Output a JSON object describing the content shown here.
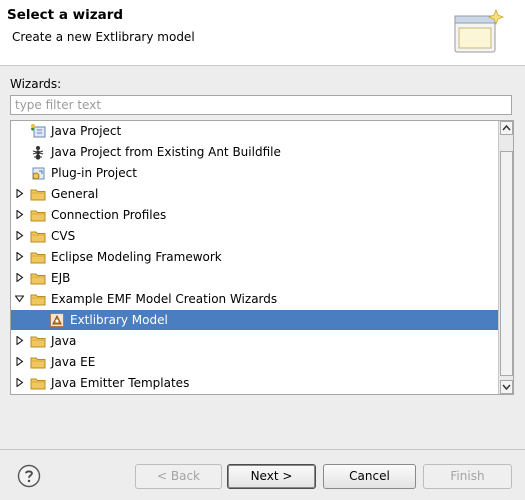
{
  "header": {
    "title": "Select a wizard",
    "description": "Create a new Extlibrary model",
    "banner_icon": "wizard-banner-icon"
  },
  "wizards_label": "Wizards:",
  "filter": {
    "placeholder": "type filter text",
    "value": ""
  },
  "tree": {
    "items": [
      {
        "label": "Java Project",
        "icon": "java-project-icon",
        "expandable": false,
        "expanded": false,
        "selected": false
      },
      {
        "label": "Java Project from Existing Ant Buildfile",
        "icon": "ant-icon",
        "expandable": false,
        "expanded": false,
        "selected": false
      },
      {
        "label": "Plug-in Project",
        "icon": "plugin-project-icon",
        "expandable": false,
        "expanded": false,
        "selected": false
      },
      {
        "label": "General",
        "icon": "folder-icon",
        "expandable": true,
        "expanded": false,
        "selected": false
      },
      {
        "label": "Connection Profiles",
        "icon": "folder-icon",
        "expandable": true,
        "expanded": false,
        "selected": false
      },
      {
        "label": "CVS",
        "icon": "folder-icon",
        "expandable": true,
        "expanded": false,
        "selected": false
      },
      {
        "label": "Eclipse Modeling Framework",
        "icon": "folder-icon",
        "expandable": true,
        "expanded": false,
        "selected": false
      },
      {
        "label": "EJB",
        "icon": "folder-icon",
        "expandable": true,
        "expanded": false,
        "selected": false
      },
      {
        "label": "Example EMF Model Creation Wizards",
        "icon": "folder-icon",
        "expandable": true,
        "expanded": true,
        "selected": false
      },
      {
        "label": "Extlibrary Model",
        "icon": "emf-model-icon",
        "expandable": false,
        "expanded": false,
        "selected": true
      },
      {
        "label": "Java",
        "icon": "folder-icon",
        "expandable": true,
        "expanded": false,
        "selected": false
      },
      {
        "label": "Java EE",
        "icon": "folder-icon",
        "expandable": true,
        "expanded": false,
        "selected": false
      },
      {
        "label": "Java Emitter Templates",
        "icon": "folder-icon",
        "expandable": true,
        "expanded": false,
        "selected": false
      }
    ]
  },
  "buttons": {
    "back": "< Back",
    "next": "Next >",
    "cancel": "Cancel",
    "finish": "Finish"
  },
  "colors": {
    "selection": "#4a7ec1",
    "folder": "#e8b84a",
    "dialog_bg": "#ededed"
  }
}
